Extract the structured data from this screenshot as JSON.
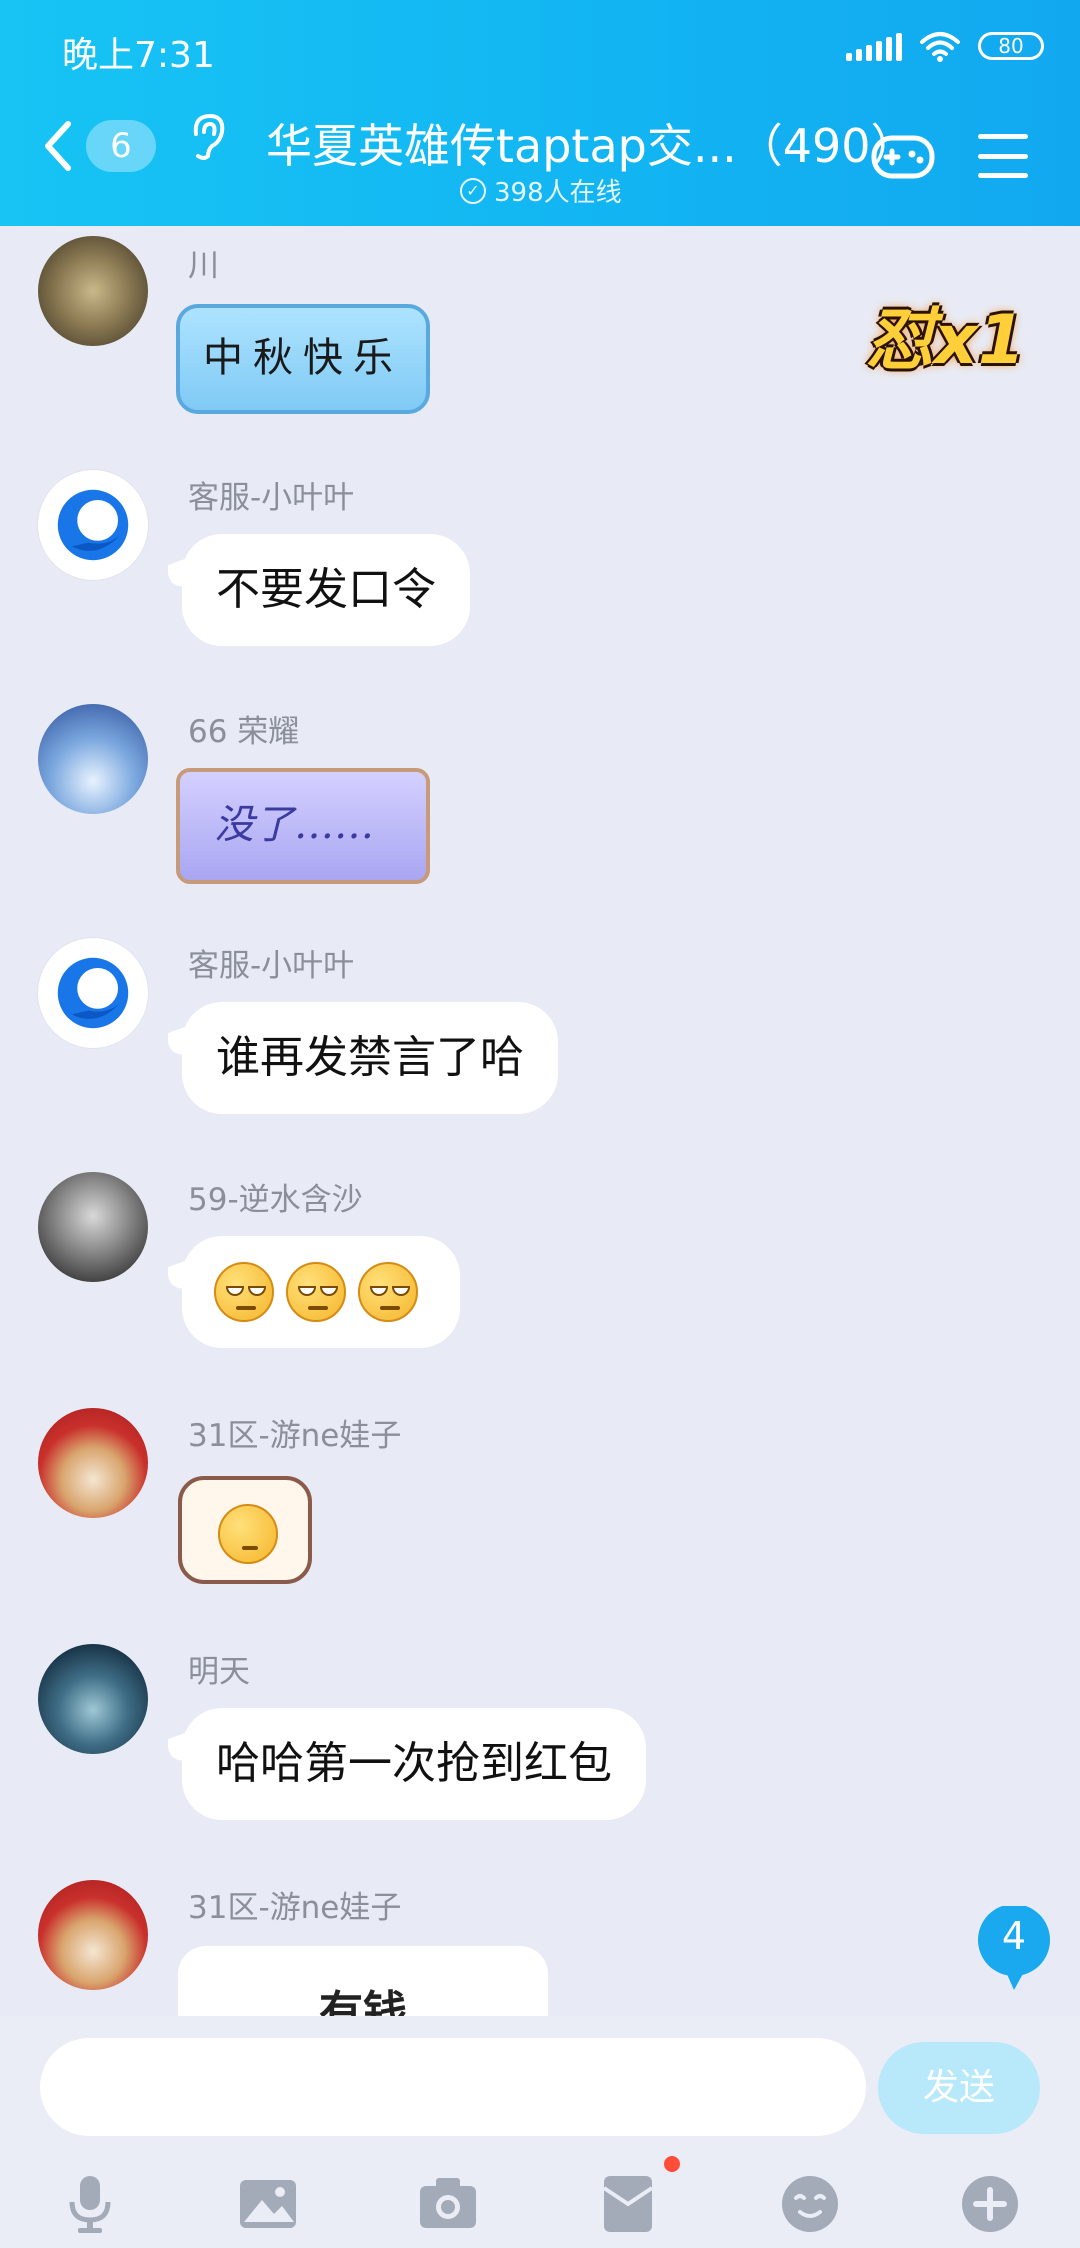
{
  "status_bar": {
    "time": "晚上7:31",
    "battery": "80"
  },
  "header": {
    "unread_count": "6",
    "title": "华夏英雄传taptap交...（490）",
    "online": "398人在线"
  },
  "combo_badge": "怼x1",
  "messages": [
    {
      "sender": "川",
      "type": "sticker",
      "sticker_text": "中秋快乐"
    },
    {
      "sender": "客服-小叶叶",
      "type": "text",
      "text": "不要发口令"
    },
    {
      "sender": "66 荣耀",
      "type": "sticker",
      "sticker_text": "没了……"
    },
    {
      "sender": "客服-小叶叶",
      "type": "text",
      "text": "谁再发禁言了哈"
    },
    {
      "sender": "59-逆水含沙",
      "type": "emoji",
      "count": 3
    },
    {
      "sender": "31区-游ne娃子",
      "type": "sticker"
    },
    {
      "sender": "明天",
      "type": "text",
      "text": "哈哈第一次抢到红包"
    },
    {
      "sender": "31区-游ne娃子",
      "type": "text",
      "text": "有钱"
    }
  ],
  "new_message_count": "4",
  "composer": {
    "send_label": "发送"
  },
  "toolbar": [
    "mic-icon",
    "image-icon",
    "camera-icon",
    "red-packet-icon",
    "emoji-icon",
    "plus-icon"
  ],
  "colors": {
    "header": "#12b4f2",
    "background": "#e8ebf5",
    "send_disabled": "#b7e9fb",
    "badge": "#1aa9ee"
  }
}
